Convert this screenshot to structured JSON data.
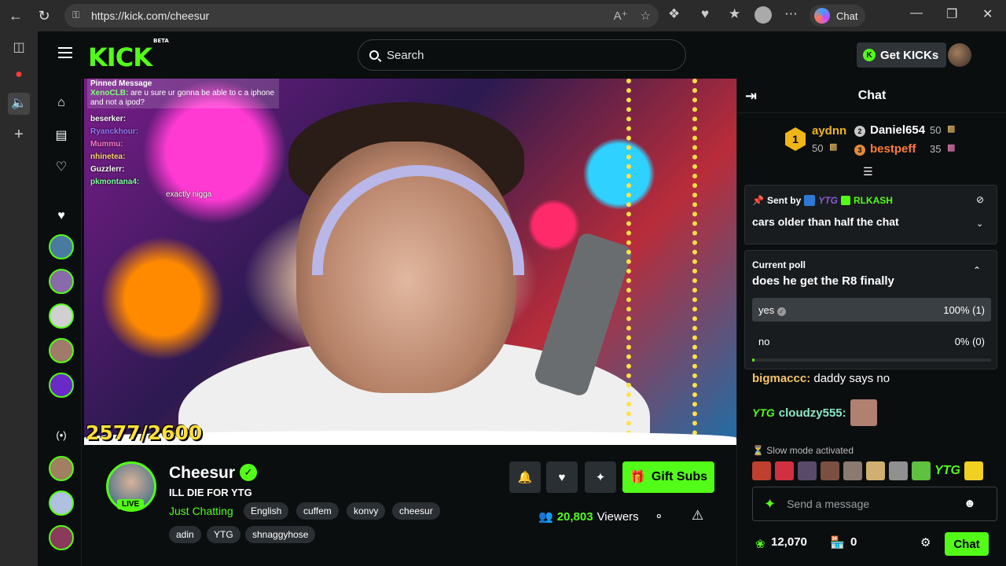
{
  "browser": {
    "url": "https://kick.com/cheesur",
    "copilot_label": "Chat"
  },
  "header": {
    "logo": "KICK",
    "logo_badge": "BETA",
    "search_placeholder": "Search",
    "get_kicks_label": "Get KICKs"
  },
  "video": {
    "overlay": {
      "pinned_title": "Pinned Message",
      "pinned_user": "XenoCLB:",
      "pinned_text": "are u sure ur gonna be able to c a iphone and not a ipod?",
      "lines": [
        {
          "user": "beserker:",
          "text": ""
        },
        {
          "user": "Ryanckhour:",
          "text": ""
        },
        {
          "user": "Mummu:",
          "text": ""
        },
        {
          "user": "nhinetea:",
          "text": ""
        },
        {
          "user": "Guzzlerr:",
          "text": ""
        },
        {
          "user": "pkmontana4:",
          "text": ""
        }
      ],
      "extra_text": "exactly nigga"
    },
    "sub_goal": "2577/2600"
  },
  "stream": {
    "streamer_name": "Cheesur",
    "live_label": "LIVE",
    "title": "ILL DIE FOR YTG",
    "category": "Just Chatting",
    "tags_row1": [
      "English",
      "cuffem",
      "konvy",
      "cheesur"
    ],
    "tags_row2": [
      "adin",
      "YTG",
      "shnaggyhose"
    ],
    "gift_subs_label": "Gift Subs",
    "viewers_count": "20,803",
    "viewers_label": "Viewers"
  },
  "chat": {
    "title": "Chat",
    "leaderboard": {
      "first": {
        "rank": "1",
        "name": "aydnn",
        "amount": "50"
      },
      "second": {
        "rank": "2",
        "name": "Daniel654",
        "amount": "50"
      },
      "third": {
        "rank": "3",
        "name": "bestpeff",
        "amount": "35"
      }
    },
    "pinned": {
      "sent_by_label": "Sent by",
      "badge_text": "YTG",
      "user": "RLKASH",
      "message": "cars older than half the chat"
    },
    "poll": {
      "label": "Current poll",
      "question": "does he get the R8 finally",
      "options": [
        {
          "label": "yes",
          "result": "100% (1)",
          "percent": 100
        },
        {
          "label": "no",
          "result": "0% (0)",
          "percent": 0
        }
      ],
      "progress": 0.01
    },
    "messages": [
      {
        "user": "bigmaccc:",
        "text": "daddy says no"
      },
      {
        "badge": "YTG",
        "user": "cloudzy555:",
        "text": ""
      }
    ],
    "slow_mode": "Slow mode activated",
    "emote_badge_text": "YTG",
    "input_placeholder": "Send a message",
    "kicks_count": "12,070",
    "store_count": "0",
    "chat_button": "Chat"
  },
  "colors": {
    "kick_green": "#53fc18",
    "background": "#0b0e0f",
    "panel": "#191c1f"
  }
}
